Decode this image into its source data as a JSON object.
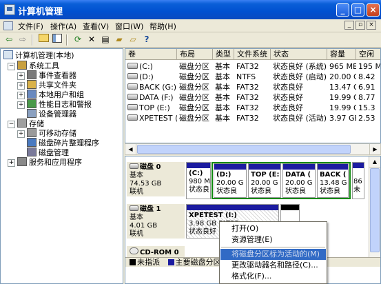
{
  "window": {
    "title": "计算机管理"
  },
  "titlebar_buttons": {
    "minimize": "_",
    "maximize": "□",
    "close": "×"
  },
  "menu": [
    {
      "label": "文件(F)"
    },
    {
      "label": "操作(A)"
    },
    {
      "label": "查看(V)"
    },
    {
      "label": "窗口(W)"
    },
    {
      "label": "帮助(H)"
    }
  ],
  "mdi_buttons": {
    "minimize": "_",
    "restore": "▫",
    "close": "×"
  },
  "toolbar": [
    "back-icon",
    "forward-icon",
    "up-folder-icon",
    "show-tree-icon",
    "refresh-icon",
    "delete-icon",
    "properties-icon",
    "open-icon",
    "explore-icon",
    "help-icon"
  ],
  "tree": {
    "root": "计算机管理(本地)",
    "items": [
      {
        "label": "系统工具",
        "level": 1,
        "expander": "−"
      },
      {
        "label": "事件查看器",
        "level": 2,
        "expander": "+"
      },
      {
        "label": "共享文件夹",
        "level": 2,
        "expander": "+"
      },
      {
        "label": "本地用户和组",
        "level": 2,
        "expander": "+"
      },
      {
        "label": "性能日志和警报",
        "level": 2,
        "expander": "+"
      },
      {
        "label": "设备管理器",
        "level": 2,
        "expander": ""
      },
      {
        "label": "存储",
        "level": 1,
        "expander": "−"
      },
      {
        "label": "可移动存储",
        "level": 2,
        "expander": "+"
      },
      {
        "label": "磁盘碎片整理程序",
        "level": 2,
        "expander": ""
      },
      {
        "label": "磁盘管理",
        "level": 2,
        "expander": ""
      },
      {
        "label": "服务和应用程序",
        "level": 1,
        "expander": "+"
      }
    ]
  },
  "volumes": {
    "columns": [
      "卷",
      "布局",
      "类型",
      "文件系统",
      "状态",
      "容量",
      "空闲"
    ],
    "rows": [
      [
        "(C:)",
        "磁盘分区",
        "基本",
        "FAT32",
        "状态良好 (系统)",
        "965 MB",
        "195 M"
      ],
      [
        "(D:)",
        "磁盘分区",
        "基本",
        "NTFS",
        "状态良好 (启动)",
        "20.00 GB",
        "8.42"
      ],
      [
        "BACK (G:)",
        "磁盘分区",
        "基本",
        "FAT32",
        "状态良好",
        "13.47 GB",
        "6.91"
      ],
      [
        "DATA (F:)",
        "磁盘分区",
        "基本",
        "FAT32",
        "状态良好",
        "19.99 GB",
        "8.77"
      ],
      [
        "TOP (E:)",
        "磁盘分区",
        "基本",
        "FAT32",
        "状态良好",
        "19.99 GB",
        "15.3"
      ],
      [
        "XPETEST (I:)",
        "磁盘分区",
        "基本",
        "FAT32",
        "状态良好 (活动)",
        "3.97 GB",
        "2.53"
      ]
    ]
  },
  "disks": [
    {
      "name": "磁盘 0",
      "type": "基本",
      "size": "74.53 GB",
      "status": "联机",
      "partitions": [
        {
          "name": "(C:)",
          "size": "980 M",
          "status": "状态良",
          "bar": "#1c1ca0"
        },
        {
          "name": "(D:)",
          "size": "20.00 G",
          "status": "状态良",
          "bar": "#1c1ca0"
        },
        {
          "name": "TOP (E:",
          "size": "20.00 G",
          "status": "状态良",
          "bar": "#1c1ca0"
        },
        {
          "name": "DATA (",
          "size": "20.00 G",
          "status": "状态良",
          "bar": "#1c1ca0"
        },
        {
          "name": "BACK (",
          "size": "13.48 G",
          "status": "状态良",
          "bar": "#1c1ca0"
        },
        {
          "name": "",
          "size": "86",
          "status": "未",
          "bar": "#1c1ca0"
        }
      ]
    },
    {
      "name": "磁盘 1",
      "type": "基本",
      "size": "4.01 GB",
      "status": "联机",
      "partitions": [
        {
          "name": "XPETEST (I:)",
          "size": "3.98 GB FAT32",
          "status": "状态良好",
          "bar": "#1c1ca0"
        },
        {
          "name": "",
          "size": "",
          "status": "",
          "bar": "#000000"
        }
      ]
    },
    {
      "name": "CD-ROM 0",
      "type": "",
      "size": "",
      "status": "",
      "partitions": []
    }
  ],
  "legend": [
    {
      "label": "未指派",
      "color": "#000000"
    },
    {
      "label": "主要磁盘分区",
      "color": "#1c1ca0"
    }
  ],
  "context_menu": {
    "items": [
      {
        "label": "打开(O)",
        "enabled": true,
        "selected": false
      },
      {
        "label": "资源管理(E)",
        "enabled": true,
        "selected": false
      },
      {
        "label": "将磁盘分区标为活动的(M)",
        "enabled": false,
        "selected": true
      },
      {
        "label": "更改驱动器名和路径(C)...",
        "enabled": true,
        "selected": false
      },
      {
        "label": "格式化(F)...",
        "enabled": true,
        "selected": false
      }
    ]
  },
  "colors": {
    "titlebar": "#0a5fd8",
    "selection": "#316ac5",
    "selection_border": "#0f8a0f",
    "primary_partition": "#1c1ca0"
  }
}
